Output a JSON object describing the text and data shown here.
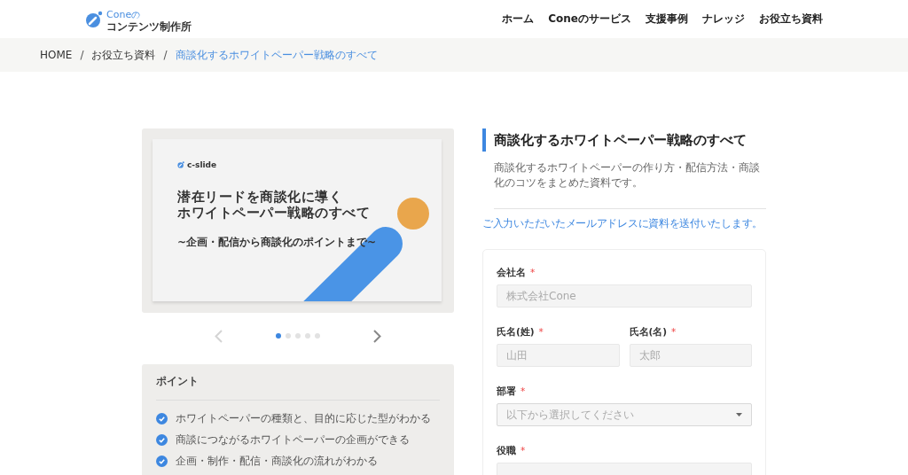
{
  "header": {
    "logo": {
      "brand": "Cone",
      "particle": "の",
      "name": "コンテンツ制作所"
    },
    "nav": [
      {
        "label": "ホーム"
      },
      {
        "label": "Coneのサービス"
      },
      {
        "label": "支援事例"
      },
      {
        "label": "ナレッジ"
      },
      {
        "label": "お役立ち資料"
      }
    ]
  },
  "breadcrumb": {
    "separators": [
      "/",
      "/"
    ],
    "items": [
      {
        "label": "HOME",
        "current": false
      },
      {
        "label": "お役立ち資料",
        "current": false
      },
      {
        "label": "商談化するホワイトペーパー戦略のすべて",
        "current": true
      }
    ]
  },
  "carousel": {
    "slide": {
      "brand": "c-slide",
      "title_lines": [
        "潜在リードを商談化に導く",
        "ホワイトペーパー戦略のすべて"
      ],
      "subtitle": "~企画・配信から商談化のポイントまで~"
    },
    "prev": {
      "disabled": true
    },
    "next": {
      "disabled": false
    },
    "dots": [
      {
        "selected": true
      },
      {
        "selected": false
      },
      {
        "selected": false
      },
      {
        "selected": false
      },
      {
        "selected": false
      }
    ]
  },
  "points": {
    "title": "ポイント",
    "items": [
      {
        "text": "ホワイトペーパーの種類と、目的に応じた型がわかる",
        "checked": true
      },
      {
        "text": "商談につながるホワイトペーパーの企画ができる",
        "checked": true
      },
      {
        "text": "企画・制作・配信・商談化の流れがわかる",
        "checked": true
      }
    ]
  },
  "document": {
    "title": "商談化するホワイトペーパー戦略のすべて",
    "description": "商談化するホワイトペーパーの作り方・配信方法・商談化のコツをまとめた資料です。",
    "notice": "ご入力いただいたメールアドレスに資料を送付いたします。"
  },
  "form": {
    "rows": [
      {
        "kind": "text",
        "fields": [
          {
            "label": "会社名",
            "required_mark": "*",
            "placeholder": "株式会社Cone"
          }
        ]
      },
      {
        "kind": "text",
        "fields": [
          {
            "label": "氏名(姓)",
            "required_mark": "*",
            "placeholder": "山田"
          },
          {
            "label": "氏名(名)",
            "required_mark": "*",
            "placeholder": "太郎"
          }
        ]
      },
      {
        "kind": "select",
        "fields": [
          {
            "label": "部署",
            "required_mark": "*",
            "placeholder": "以下から選択してください"
          }
        ]
      },
      {
        "kind": "text",
        "fields": [
          {
            "label": "役職",
            "required_mark": "*"
          }
        ]
      }
    ]
  }
}
